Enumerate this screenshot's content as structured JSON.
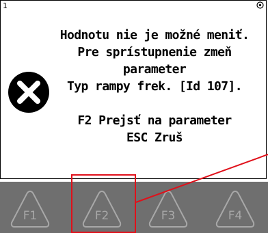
{
  "screen": {
    "corner_number": "1",
    "message_lines": [
      "Hodnotu nie je možné meniť.",
      "Pre sprístupnenie zmeň",
      "parameter",
      "Typ rampy frek. [Id 107].",
      "",
      "F2 Prejsť na parameter",
      "ESC Zruš"
    ],
    "error_icon": "error-x-circle-icon",
    "corner_icon": "circle-dot-icon"
  },
  "function_keys": [
    {
      "label": "F1"
    },
    {
      "label": "F2"
    },
    {
      "label": "F3"
    },
    {
      "label": "F4"
    }
  ],
  "colors": {
    "key_bar": "#6f6f6f",
    "key_outline": "#a8a8a8",
    "highlight": "#e0101a"
  }
}
